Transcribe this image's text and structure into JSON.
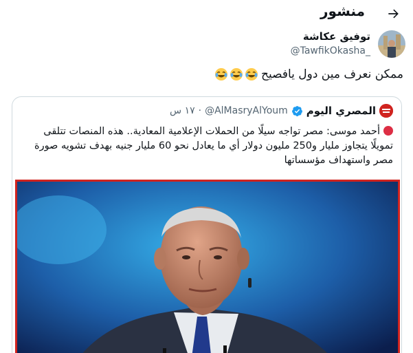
{
  "header": {
    "title": "منشور"
  },
  "author": {
    "name": "توفيق عكاشة",
    "handle": "@TawfikOkasha_"
  },
  "tweet": {
    "text": "ممكن نعرف مين دول يافصيح",
    "emojis": [
      "😂",
      "😂",
      "😂"
    ]
  },
  "quote": {
    "name": "المصري اليوم",
    "handle": "@AlMasryAlYoum",
    "separator": "·",
    "time": "١٧ س",
    "logo_text": "المصري اليوم",
    "body": "أحمد موسى: مصر تواجه سيلًا من الحملات الإعلامية المعادية.. هذه المنصات تتلقى تمويلًا يتجاوز مليار و250 مليون دولار أي ما يعادل نحو 60 مليار جنيه بهدف تشويه صورة مصر واستهداف مؤسساتها"
  },
  "colors": {
    "brand_red": "#d0231f",
    "verified_blue": "#1d9bf0",
    "secondary_text": "#536471",
    "border": "#cfd9de"
  },
  "icons": {
    "back": "arrow-right-icon",
    "verified": "verified-badge-icon",
    "bullet": "red-circle-icon"
  }
}
